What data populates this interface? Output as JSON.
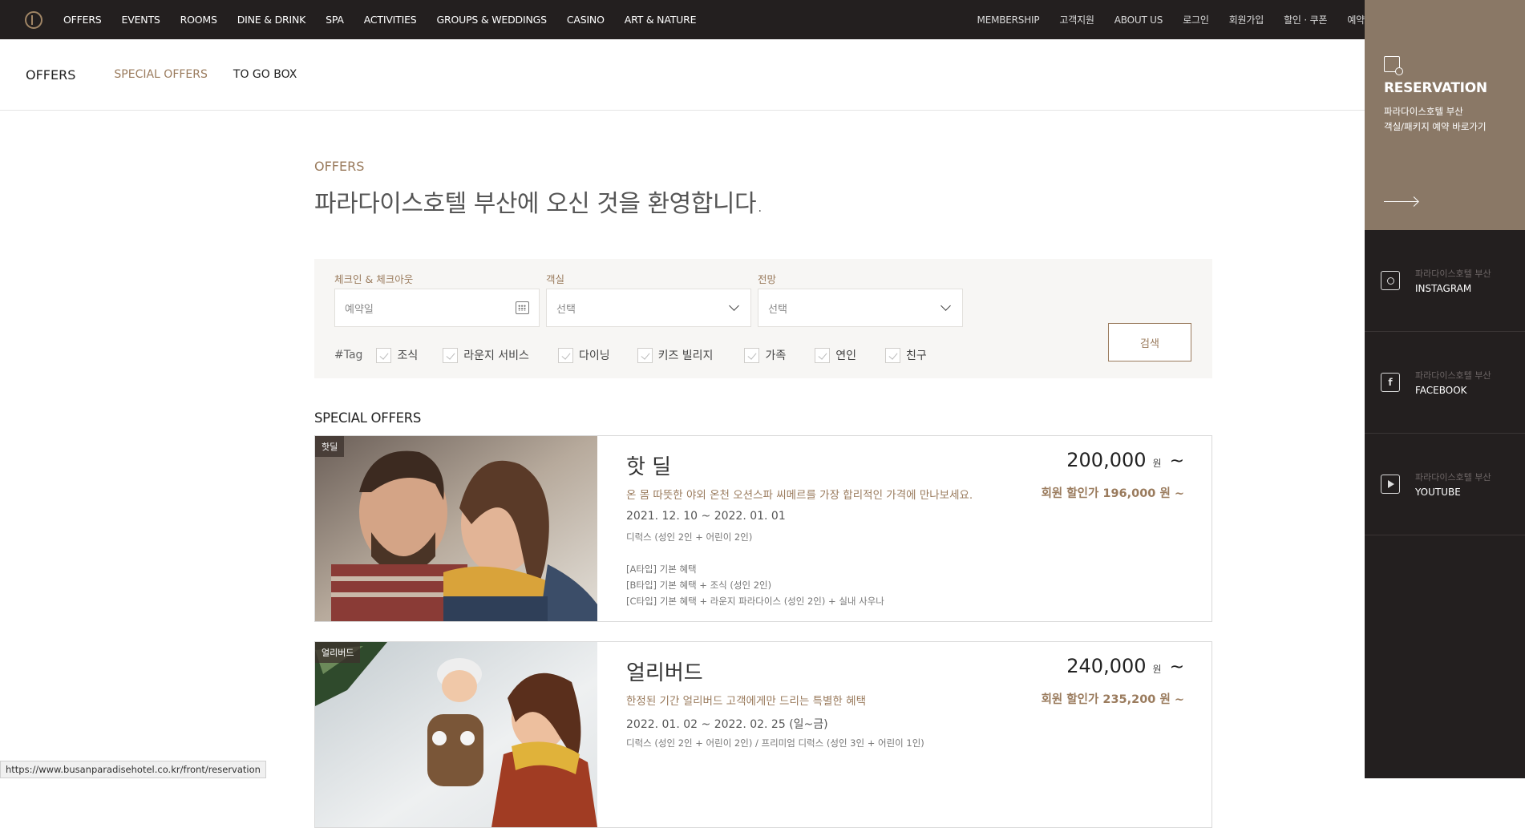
{
  "topnav": {
    "items": [
      "OFFERS",
      "EVENTS",
      "ROOMS",
      "DINE & DRINK",
      "SPA",
      "ACTIVITIES",
      "GROUPS & WEDDINGS",
      "CASINO",
      "ART & NATURE"
    ],
    "right_items": [
      "MEMBERSHIP",
      "고객지원",
      "ABOUT US",
      "로그인",
      "회원가입",
      "할인 · 쿠폰",
      "예약"
    ]
  },
  "subnav": {
    "title": "OFFERS",
    "links": [
      "SPECIAL OFFERS",
      "TO GO BOX"
    ]
  },
  "main": {
    "section_label": "OFFERS",
    "welcome": "파라다이스호텔 부산에 오신 것을 환영합니다."
  },
  "search": {
    "checkin_label": "체크인 & 체크아웃",
    "checkin_placeholder": "예약일",
    "room_label": "객실",
    "room_value": "선택",
    "view_label": "전망",
    "view_value": "선택",
    "tag_label": "#Tag",
    "tags": [
      "조식",
      "라운지 서비스",
      "다이닝",
      "키즈 빌리지",
      "가족",
      "연인",
      "친구"
    ],
    "button": "검색"
  },
  "special_offers": {
    "title": "SPECIAL OFFERS",
    "cards": [
      {
        "badge": "핫딜",
        "name": "핫 딜",
        "desc": "온 몸 따뜻한 야외 온천 오션스파 씨메르를 가장 합리적인 가격에 만나보세요.",
        "dates": "2021. 12. 10 ~ 2022. 01. 01",
        "room": "디럭스 (성인 2인 + 어린이 2인)",
        "benefits": [
          "[A타입] 기본 혜택",
          "[B타입] 기본 혜택 + 조식 (성인 2인)",
          "[C타입] 기본 혜택 + 라운지 파라다이스 (성인 2인) + 실내 사우나"
        ],
        "price": "200,000",
        "unit": "원",
        "tilde": "~",
        "member_price": "회원 할인가 196,000 원 ~"
      },
      {
        "badge": "얼리버드",
        "name": "얼리버드",
        "desc": "한정된 기간 얼리버드 고객에게만 드리는 특별한 혜택",
        "dates": "2022. 01. 02 ~ 2022. 02. 25 (일~금)",
        "room": "디럭스 (성인 2인 + 어린이 2인) / 프리미엄 디럭스 (성인 3인 + 어린이 1인)",
        "benefits": [],
        "price": "240,000",
        "unit": "원",
        "tilde": "~",
        "member_price": "회원 할인가 235,200 원 ~"
      }
    ]
  },
  "right_panel": {
    "reservation_title": "RESERVATION",
    "reservation_sub1": "파라다이스호텔 부산",
    "reservation_sub2": "객실/패키지 예약 바로가기",
    "socials": [
      {
        "small": "파라다이스호텔 부산",
        "big": "INSTAGRAM",
        "icon": "instagram-icon"
      },
      {
        "small": "파라다이스호텔 부산",
        "big": "FACEBOOK",
        "icon": "facebook-icon"
      },
      {
        "small": "파라다이스호텔 부산",
        "big": "YOUTUBE",
        "icon": "youtube-icon"
      }
    ]
  },
  "status_bar": "https://www.busanparadisehotel.co.kr/front/reservation",
  "colors": {
    "accent": "#9a7b5d",
    "nav_bg": "#231f1f",
    "reservation_bg": "#8a7866"
  }
}
